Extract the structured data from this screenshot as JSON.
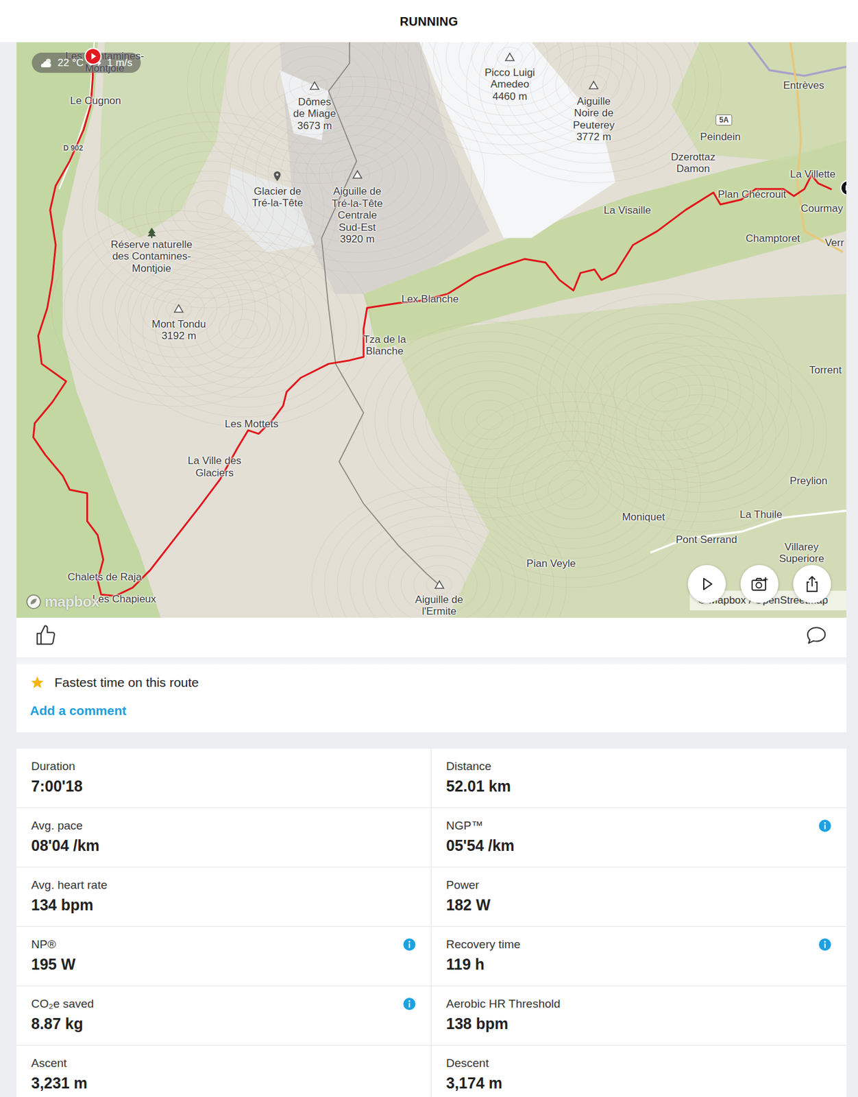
{
  "header": {
    "title": "RUNNING"
  },
  "map": {
    "weather": {
      "temperature": "22 °C",
      "wind": "1 m/s"
    },
    "labels": [
      {
        "lines": [
          "Les Contamines-",
          "Montjoie"
        ],
        "kind": "town"
      },
      {
        "lines": [
          "Le Cugnon"
        ],
        "kind": "town"
      },
      {
        "lines": [
          "D 902"
        ],
        "kind": "road"
      },
      {
        "lines": [
          "Dômes",
          "de Miage",
          "3673 m"
        ],
        "kind": "peak"
      },
      {
        "lines": [
          "Glacier de",
          "Tré-la-Tête"
        ],
        "kind": "glacier"
      },
      {
        "lines": [
          "Aiguille de",
          "Tré-la-Tête",
          "Centrale",
          "Sud-Est",
          "3920 m"
        ],
        "kind": "peak"
      },
      {
        "lines": [
          "Picco Luigi",
          "Amedeo",
          "4460 m"
        ],
        "kind": "peak"
      },
      {
        "lines": [
          "Aiguille",
          "Noire de",
          "Peuterey",
          "3772 m"
        ],
        "kind": "peak"
      },
      {
        "lines": [
          "Entrèves"
        ],
        "kind": "town"
      },
      {
        "lines": [
          "5A"
        ],
        "kind": "shield"
      },
      {
        "lines": [
          "Peindein"
        ],
        "kind": "town"
      },
      {
        "lines": [
          "Dzerottaz",
          "Damon"
        ],
        "kind": "town"
      },
      {
        "lines": [
          "La Villette"
        ],
        "kind": "town"
      },
      {
        "lines": [
          "Plan Chécrouit"
        ],
        "kind": "town"
      },
      {
        "lines": [
          "Courmay"
        ],
        "kind": "town"
      },
      {
        "lines": [
          "La Visaille"
        ],
        "kind": "town"
      },
      {
        "lines": [
          "Champtoret"
        ],
        "kind": "town"
      },
      {
        "lines": [
          "Verr"
        ],
        "kind": "town"
      },
      {
        "lines": [
          "Réserve naturelle",
          "des Contamines-",
          "Montjoie"
        ],
        "kind": "reserve"
      },
      {
        "lines": [
          "Lex Blanche"
        ],
        "kind": "town"
      },
      {
        "lines": [
          "Mont Tondu",
          "3192 m"
        ],
        "kind": "peak"
      },
      {
        "lines": [
          "Tza de la",
          "Blanche"
        ],
        "kind": "town"
      },
      {
        "lines": [
          "Torrent"
        ],
        "kind": "town"
      },
      {
        "lines": [
          "Les Mottets"
        ],
        "kind": "town"
      },
      {
        "lines": [
          "La Ville des",
          "Glaciers"
        ],
        "kind": "town"
      },
      {
        "lines": [
          "Preylion"
        ],
        "kind": "town"
      },
      {
        "lines": [
          "La Thuile"
        ],
        "kind": "town"
      },
      {
        "lines": [
          "Moniquet"
        ],
        "kind": "town"
      },
      {
        "lines": [
          "Pont Serrand"
        ],
        "kind": "town"
      },
      {
        "lines": [
          "Villarey",
          "Superiore"
        ],
        "kind": "town"
      },
      {
        "lines": [
          "Pian Veyle"
        ],
        "kind": "town"
      },
      {
        "lines": [
          "Chalets de Raja"
        ],
        "kind": "town"
      },
      {
        "lines": [
          "Les Chapieux"
        ],
        "kind": "town"
      },
      {
        "lines": [
          "Aiguille de",
          "l'Ermite"
        ],
        "kind": "peak"
      }
    ],
    "logo": "mapbox",
    "attribution": "© Mapbox / OpenStreetMap"
  },
  "achievements": [
    {
      "text": "Fastest time on this route"
    }
  ],
  "comment_link": "Add a comment",
  "stats": [
    {
      "label": "Duration",
      "value": "7:00'18",
      "info": false
    },
    {
      "label": "Distance",
      "value": "52.01 km",
      "info": false
    },
    {
      "label": "Avg. pace",
      "value": "08'04 /km",
      "info": false
    },
    {
      "label": "NGP™",
      "value": "05'54 /km",
      "info": true
    },
    {
      "label": "Avg. heart rate",
      "value": "134 bpm",
      "info": false
    },
    {
      "label": "Power",
      "value": "182 W",
      "info": false
    },
    {
      "label": "NP®",
      "value": "195 W",
      "info": true
    },
    {
      "label": "Recovery time",
      "value": "119 h",
      "info": true
    },
    {
      "label": "CO₂e saved",
      "value": "8.87 kg",
      "info": true
    },
    {
      "label": "Aerobic HR Threshold",
      "value": "138 bpm",
      "info": false
    },
    {
      "label": "Ascent",
      "value": "3,231 m",
      "info": false
    },
    {
      "label": "Descent",
      "value": "3,174 m",
      "info": false
    }
  ]
}
